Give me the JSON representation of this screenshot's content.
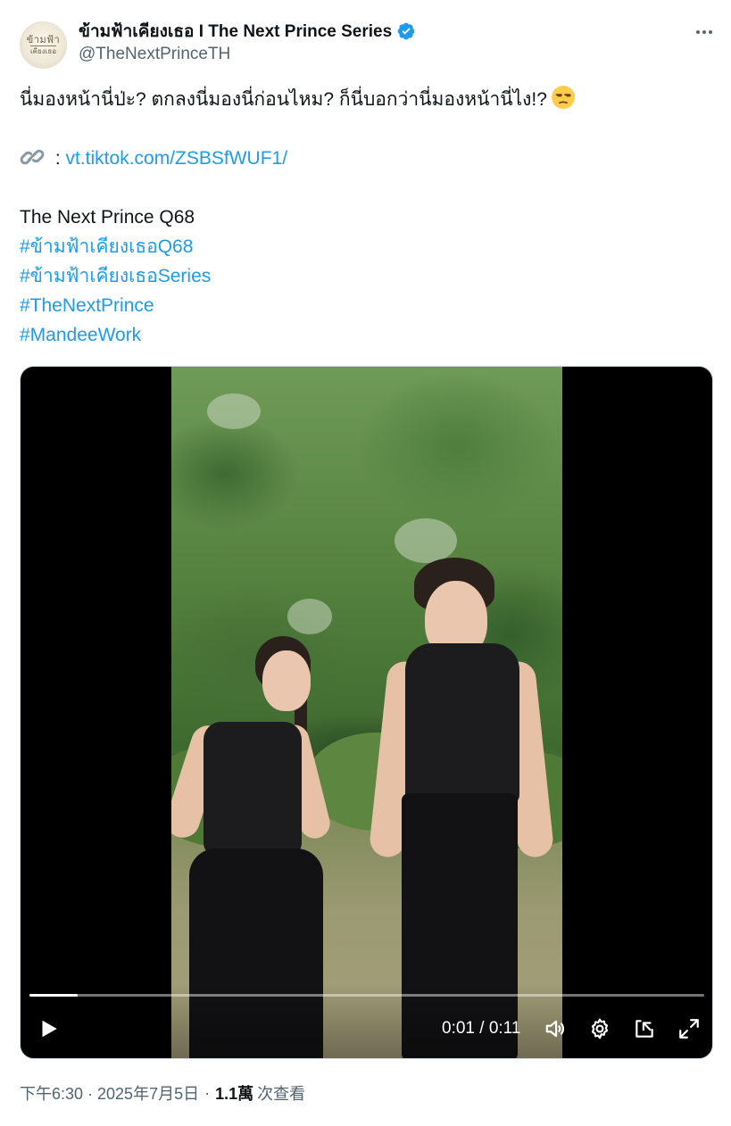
{
  "author": {
    "display_name": "ข้ามฟ้าเคียงเธอ I The Next Prince Series",
    "handle": "@TheNextPrinceTH",
    "avatar_text_line1": "ข้ามฟ้า",
    "avatar_text_line2": "เคียงเธอ",
    "verified_color": "#1d9bf0"
  },
  "tweet": {
    "line1": "นี่มองหน้านี่ป่ะ? ตกลงนี่มองนี่ก่อนไหม? ก็นี่บอกว่านี่มองหน้านี่ไง!?",
    "line1_emoji": "unamused-face-emoji",
    "link_prefix": " : ",
    "link_emoji": "link-emoji",
    "link_text": "vt.tiktok.com/ZSBSfWUF1/",
    "show_title": "The Next Prince Q68",
    "hashtags": [
      "#ข้ามฟ้าเคียงเธอQ68",
      "#ข้ามฟ้าเคียงเธอSeries",
      "#TheNextPrince",
      "#MandeeWork"
    ]
  },
  "video": {
    "time_display": "0:01 / 0:11",
    "progress_fraction": 0.072,
    "controls": [
      "play-icon",
      "volume-icon",
      "settings-gear-icon",
      "pop-out-icon",
      "fullscreen-icon"
    ]
  },
  "meta": {
    "timestamp": "下午6:30 · 2025年7月5日",
    "separator": "·",
    "views_count": "1.1萬",
    "views_label": "次查看"
  },
  "colors": {
    "link": "#1d9bf0",
    "text_primary": "#0f1419",
    "text_secondary": "#536471"
  }
}
